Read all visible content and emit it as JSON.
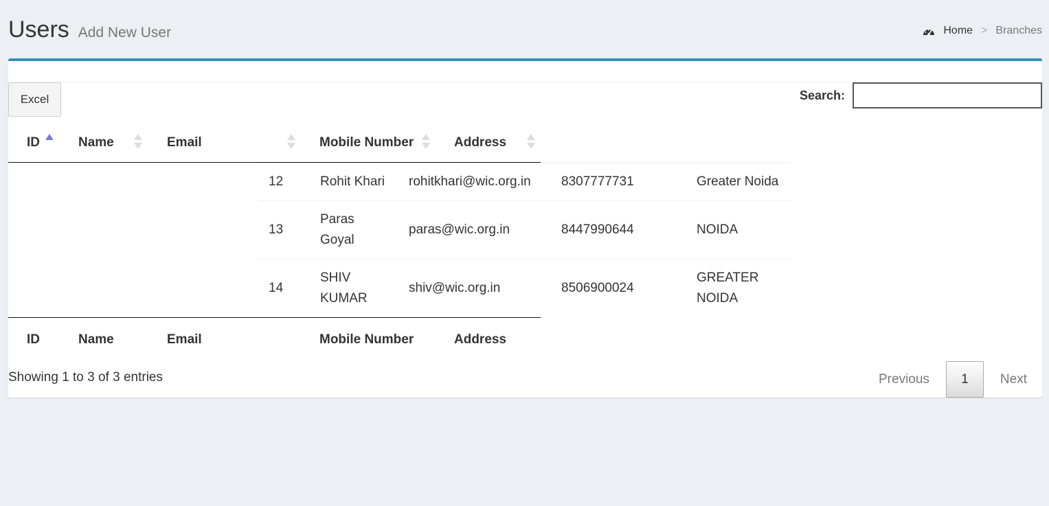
{
  "header": {
    "title": "Users",
    "subtitle": "Add New User",
    "breadcrumb": {
      "home_icon": "dashboard-icon",
      "home": "Home",
      "separator": ">",
      "current": "Branches"
    }
  },
  "toolbar": {
    "excel_label": "Excel",
    "search_label": "Search:",
    "search_value": ""
  },
  "table": {
    "columns": [
      "ID",
      "Name",
      "Email",
      "Mobile Number",
      "Address"
    ],
    "sorted_column": "ID",
    "sort_direction": "ascending",
    "rows": [
      {
        "id": "12",
        "name": "Rohit Khari",
        "email": "rohitkhari@wic.org.in",
        "mobile": "8307777731",
        "address": "Greater Noida"
      },
      {
        "id": "13",
        "name": "Paras Goyal",
        "email": "paras@wic.org.in",
        "mobile": "8447990644",
        "address": "NOIDA"
      },
      {
        "id": "14",
        "name": "SHIV KUMAR",
        "email": "shiv@wic.org.in",
        "mobile": "8506900024",
        "address": "GREATER NOIDA"
      }
    ]
  },
  "footer": {
    "info": "Showing 1 to 3 of 3 entries",
    "pagination": {
      "previous": "Previous",
      "current": "1",
      "next": "Next"
    }
  },
  "colors": {
    "accent": "#3c8dbc",
    "background": "#ecf0f5",
    "sort_active": "#7b7bd4"
  }
}
